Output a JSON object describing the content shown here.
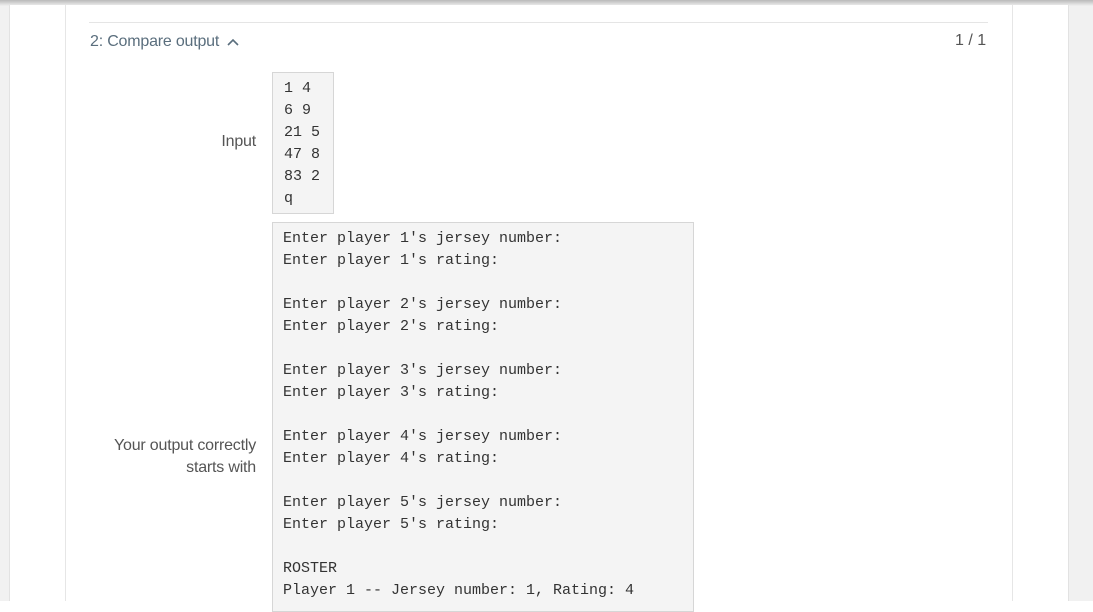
{
  "compare": {
    "section_title": "2: Compare output",
    "score": "1 / 1",
    "input_label": "Input",
    "output_label": "Your output correctly starts with",
    "input_lines": [
      "1 4",
      "6 9",
      "21 5",
      "47 8",
      "83 2",
      "q"
    ],
    "output_lines": [
      "Enter player 1's jersey number:",
      "Enter player 1's rating:",
      "",
      "Enter player 2's jersey number:",
      "Enter player 2's rating:",
      "",
      "Enter player 3's jersey number:",
      "Enter player 3's rating:",
      "",
      "Enter player 4's jersey number:",
      "Enter player 4's rating:",
      "",
      "Enter player 5's jersey number:",
      "Enter player 5's rating:",
      "",
      "ROSTER",
      "Player 1 -- Jersey number: 1, Rating: 4"
    ]
  },
  "icons": {
    "toggle": "chevron-up-icon"
  },
  "colors": {
    "title": "#5a6e7d",
    "code_background": "#f4f4f4",
    "code_border": "#d6d6d6"
  }
}
